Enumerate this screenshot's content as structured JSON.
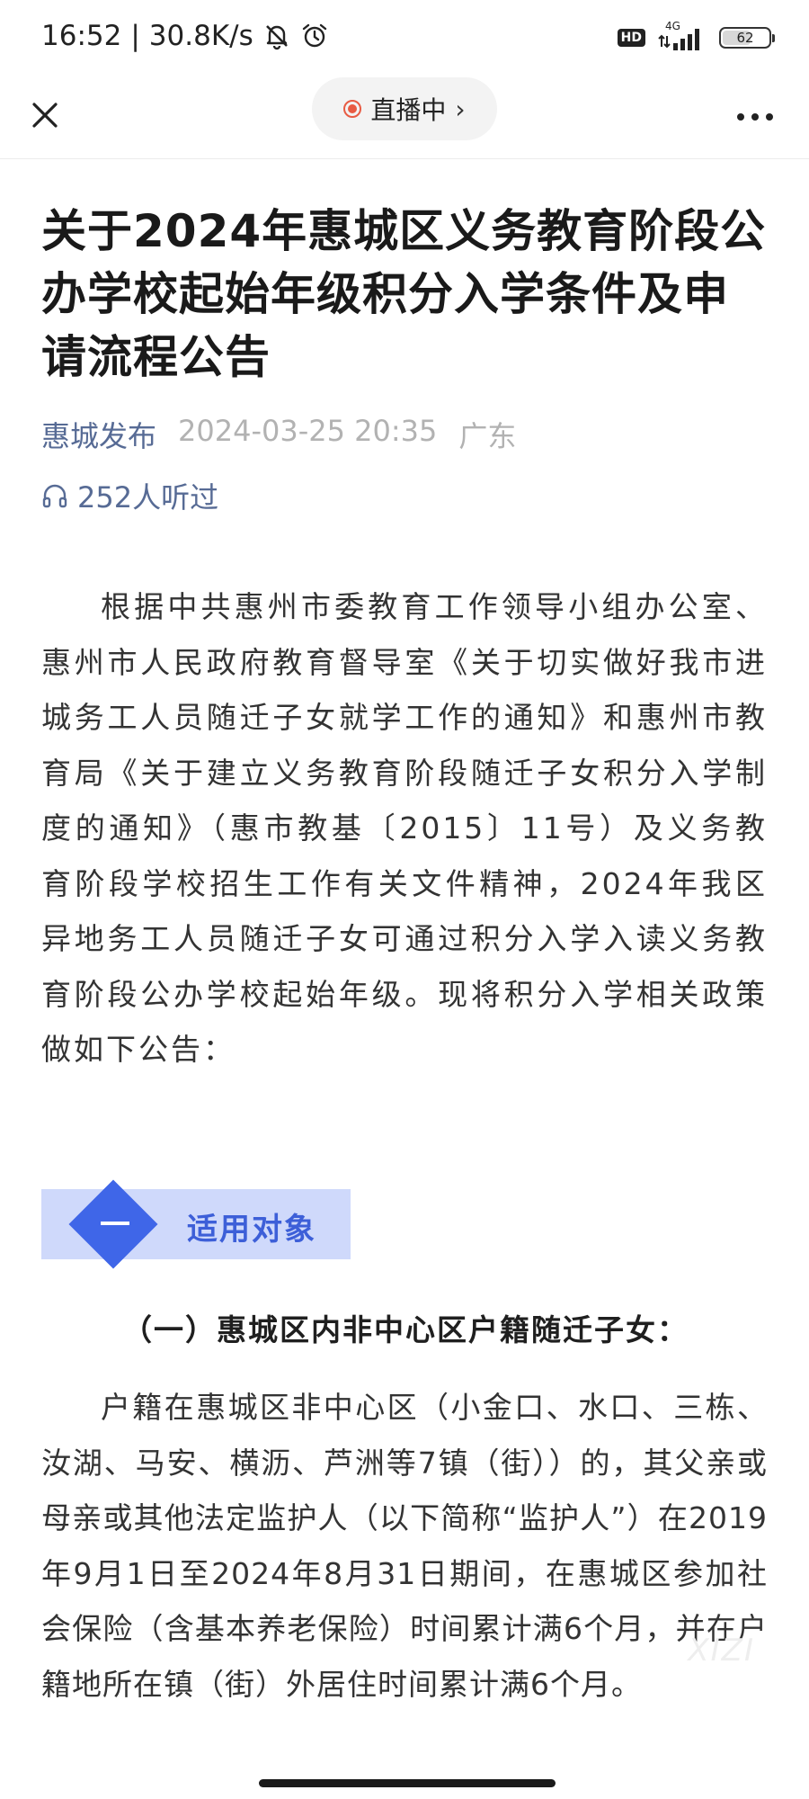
{
  "status_bar": {
    "time": "16:52",
    "net_speed": "30.8K/s",
    "hd": "HD",
    "network": "4G",
    "battery": "62",
    "battery_level_percent": 62
  },
  "nav": {
    "live_label": "直播中"
  },
  "article": {
    "title": "关于2024年惠城区义务教育阶段公办学校起始年级积分入学条件及申请流程公告",
    "author": "惠城发布",
    "date": "2024-03-25 20:35",
    "region": "广东",
    "listen_count": "252人听过",
    "intro_paragraph": "根据中共惠州市委教育工作领导小组办公室、惠州市人民政府教育督导室《关于切实做好我市进城务工人员随迁子女就学工作的通知》和惠州市教育局《关于建立义务教育阶段随迁子女积分入学制度的通知》（惠市教基〔2015〕11号）及义务教育阶段学校招生工作有关文件精神，2024年我区异地务工人员随迁子女可通过积分入学入读义务教育阶段公办学校起始年级。现将积分入学相关政策做如下公告：",
    "section": {
      "number": "一",
      "label": "适用对象"
    },
    "subheading": "（一）惠城区内非中心区户籍随迁子女：",
    "body_paragraph": "户籍在惠城区非中心区（小金口、水口、三栋、汝湖、马安、横沥、芦洲等7镇（街））的，其父亲或母亲或其他法定监护人（以下简称“监护人”）在2019年9月1日至2024年8月31日期间，在惠城区参加社会保险（含基本养老保险）时间累计满6个月，并在户籍地所在镇（街）外居住时间累计满6个月。"
  },
  "watermark": "XIZI"
}
